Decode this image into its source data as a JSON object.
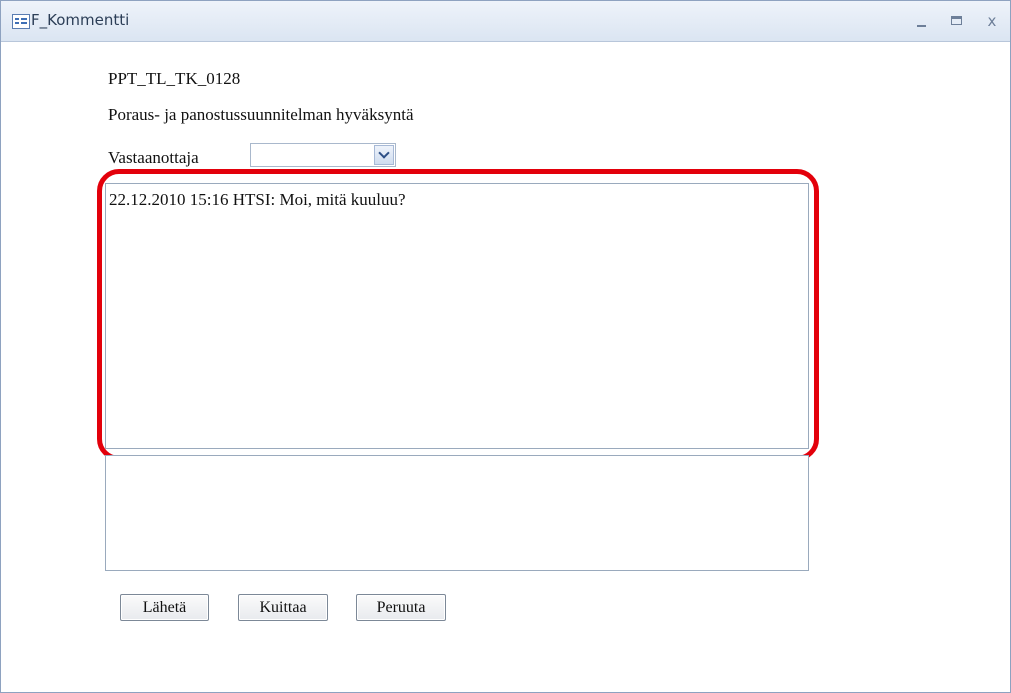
{
  "window": {
    "title": "F_Kommentti",
    "controls": {
      "minimize_icon": "minimize-icon",
      "maximize_icon": "maximize-icon",
      "close_glyph": "x"
    }
  },
  "form": {
    "code": "PPT_TL_TK_0128",
    "description": "Poraus- ja panostussuunnitelman hyväksyntä",
    "recipient_label": "Vastaanottaja",
    "recipient_value": "",
    "history_text": "22.12.2010 15:16 HTSI: Moi, mitä kuuluu?",
    "message_value": ""
  },
  "buttons": {
    "send": "Lähetä",
    "acknowledge": "Kuittaa",
    "cancel": "Peruuta"
  },
  "colors": {
    "highlight": "#e3000b",
    "title_bar": "#dbe5f2",
    "dropdown_arrow": "#2d4f86"
  }
}
